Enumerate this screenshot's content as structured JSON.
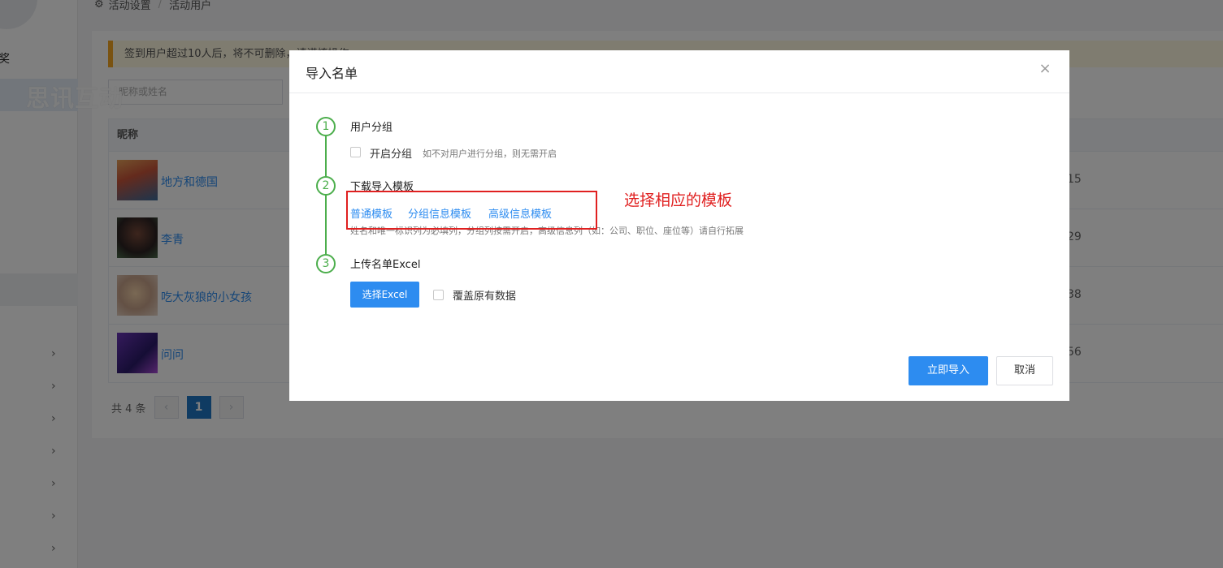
{
  "breadcrumb": {
    "items": [
      "活动设置",
      "活动用户"
    ]
  },
  "notice": {
    "text": "签到用户超过10人后，将不可删除，请谨慎操作"
  },
  "watermark": {
    "text": "思讯互动"
  },
  "search": {
    "placeholder": "昵称或姓名"
  },
  "table": {
    "header": "昵称",
    "rows": [
      {
        "nickname": "地方和德国",
        "num": "15"
      },
      {
        "nickname": "李青",
        "num": "29"
      },
      {
        "nickname": "吃大灰狼的小女孩",
        "num": "38"
      },
      {
        "nickname": "问问",
        "num": "56"
      }
    ]
  },
  "pagination": {
    "total": "共 4 条",
    "prev": "‹",
    "current": "1",
    "next": "›"
  },
  "modal": {
    "title": "导入名单",
    "close": "×",
    "step1": {
      "num": "1",
      "title": "用户分组",
      "checkbox_label": "开启分组",
      "hint": "如不对用户进行分组，则无需开启"
    },
    "step2": {
      "num": "2",
      "title": "下载导入模板",
      "links": [
        "普通模板",
        "分组信息模板",
        "高级信息模板"
      ],
      "hint": "姓名和唯一标识列为必填列，分组列按需开启，高级信息列（如：公司、职位、座位等）请自行拓展"
    },
    "step3": {
      "num": "3",
      "title": "上传名单Excel",
      "select_button": "选择Excel",
      "overwrite_label": "覆盖原有数据"
    },
    "confirm_button": "立即导入",
    "cancel_button": "取消"
  },
  "annotation": {
    "text": "选择相应的模板",
    "color": "#e02020"
  },
  "colors": {
    "primary": "#2d8cf0",
    "step_green": "#4cae4c"
  }
}
